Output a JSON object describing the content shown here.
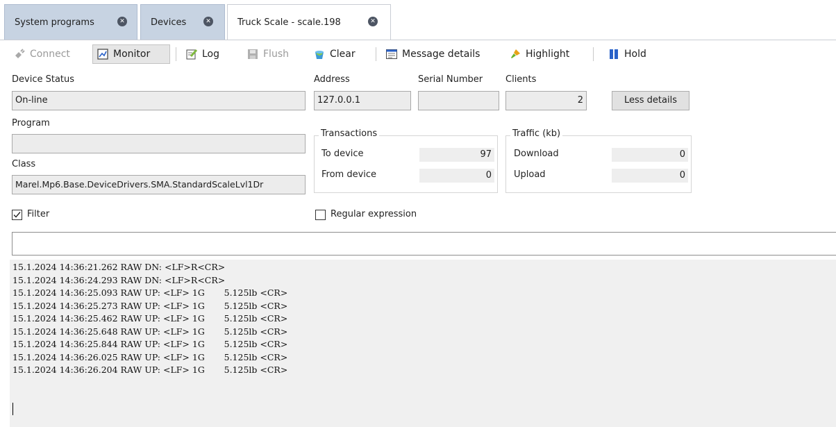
{
  "tabs": [
    {
      "label": "System programs",
      "active": false
    },
    {
      "label": "Devices",
      "active": false
    },
    {
      "label": "Truck Scale - scale.198",
      "active": true
    }
  ],
  "toolbar": {
    "connect": "Connect",
    "monitor": "Monitor",
    "log": "Log",
    "flush": "Flush",
    "clear": "Clear",
    "message_details": "Message details",
    "highlight": "Highlight",
    "hold": "Hold"
  },
  "device": {
    "status_label": "Device Status",
    "status_value": "On-line",
    "address_label": "Address",
    "address_value": "127.0.0.1",
    "serial_label": "Serial Number",
    "serial_value": "",
    "clients_label": "Clients",
    "clients_value": "2",
    "less_details": "Less details",
    "program_label": "Program",
    "program_value": "",
    "class_label": "Class",
    "class_value": "Marel.Mp6.Base.DeviceDrivers.SMA.StandardScaleLvl1Dr"
  },
  "transactions": {
    "title": "Transactions",
    "to_device_label": "To device",
    "to_device_value": "97",
    "from_device_label": "From device",
    "from_device_value": "0"
  },
  "traffic": {
    "title": "Traffic (kb)",
    "download_label": "Download",
    "download_value": "0",
    "upload_label": "Upload",
    "upload_value": "0"
  },
  "filter": {
    "label": "Filter",
    "checked": true,
    "regex_label": "Regular expression",
    "regex_checked": false,
    "value": ""
  },
  "log_lines": [
    "15.1.2024 14:36:21.262 RAW DN: <LF>R<CR>",
    "15.1.2024 14:36:24.293 RAW DN: <LF>R<CR>",
    "15.1.2024 14:36:25.093 RAW UP: <LF> 1G       5.125lb <CR>",
    "15.1.2024 14:36:25.273 RAW UP: <LF> 1G       5.125lb <CR>",
    "15.1.2024 14:36:25.462 RAW UP: <LF> 1G       5.125lb <CR>",
    "15.1.2024 14:36:25.648 RAW UP: <LF> 1G       5.125lb <CR>",
    "15.1.2024 14:36:25.844 RAW UP: <LF> 1G       5.125lb <CR>",
    "15.1.2024 14:36:26.025 RAW UP: <LF> 1G       5.125lb <CR>",
    "15.1.2024 14:36:26.204 RAW UP: <LF> 1G       5.125lb <CR>"
  ],
  "colors": {
    "tab_inactive": "#c7d3e2",
    "log_background": "#f0f0f0",
    "hold_icon": "#2a62c9"
  }
}
